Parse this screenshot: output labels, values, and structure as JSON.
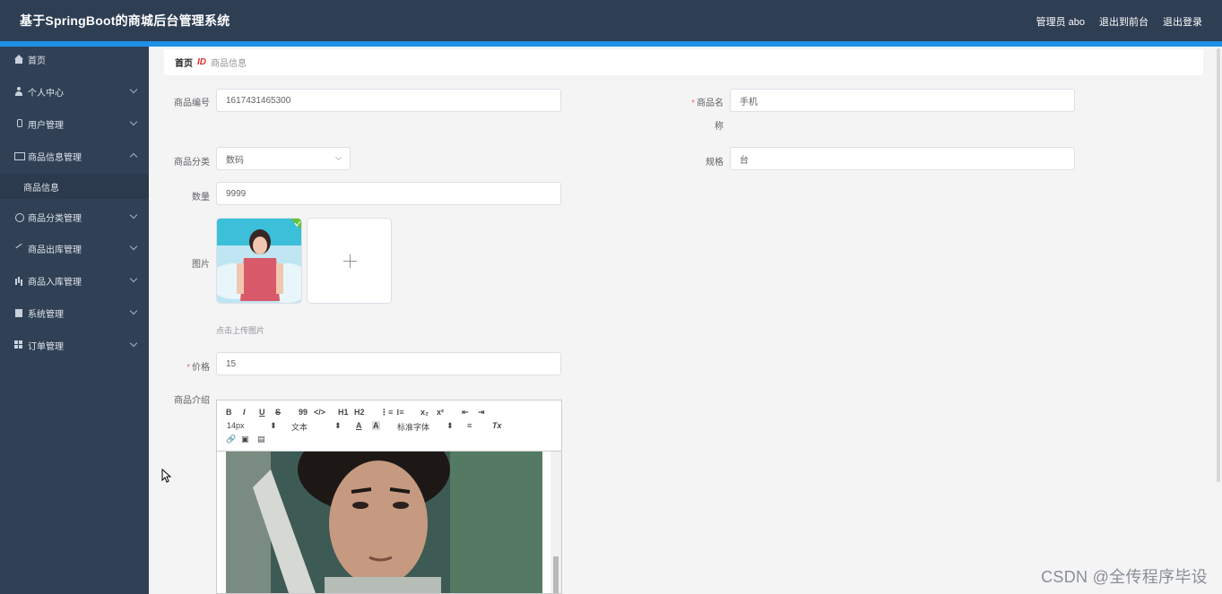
{
  "header": {
    "title": "基于SpringBoot的商城后台管理系统",
    "user": "管理员 abo",
    "to_front": "退出到前台",
    "logout": "退出登录"
  },
  "sidebar": {
    "items": [
      {
        "label": "首页",
        "icon": "home-icon"
      },
      {
        "label": "个人中心",
        "icon": "user-icon"
      },
      {
        "label": "用户管理",
        "icon": "mic-icon"
      },
      {
        "label": "商品信息管理",
        "icon": "screen-icon"
      },
      {
        "label": "商品信息",
        "icon": ""
      },
      {
        "label": "商品分类管理",
        "icon": "power-icon"
      },
      {
        "label": "商品出库管理",
        "icon": "send-icon"
      },
      {
        "label": "商品入库管理",
        "icon": "bar-chart-icon"
      },
      {
        "label": "系统管理",
        "icon": "clipboard-icon"
      },
      {
        "label": "订单管理",
        "icon": "grid-icon"
      }
    ]
  },
  "breadcrumb": {
    "home": "首页",
    "separator": "ID",
    "current": "商品信息"
  },
  "form": {
    "code_label": "商品编号",
    "code_value": "1617431465300",
    "name_label_1": "商品名",
    "name_label_2": "称",
    "name_value": "手机",
    "category_label": "商品分类",
    "category_value": "数码",
    "spec_label": "规格",
    "spec_value": "台",
    "qty_label": "数量",
    "qty_value": "9999",
    "image_label": "图片",
    "upload_tip": "点击上传图片",
    "price_label": "价格",
    "price_value": "15",
    "intro_label": "商品介绍",
    "required_mark": "*"
  },
  "editor": {
    "bold": "B",
    "italic": "I",
    "underline": "U",
    "strike": "S",
    "quote": "99",
    "code": "</>",
    "h1": "H1",
    "h2": "H2",
    "ol": "⋮≡",
    "ul": "⁝≡",
    "sub": "x₂",
    "sup": "x²",
    "outdent": "⇤",
    "indent": "⇥",
    "font_size": "14px",
    "format": "文本",
    "color": "A",
    "background": "A",
    "font_family": "标准字体",
    "align": "≡",
    "clean": "Tx"
  },
  "watermark": "CSDN @全传程序毕设",
  "colors": {
    "header_bg": "#2e3e53",
    "accent_bar": "#1e90e6",
    "sidebar_bg": "#304156",
    "required": "#f56c6c"
  }
}
